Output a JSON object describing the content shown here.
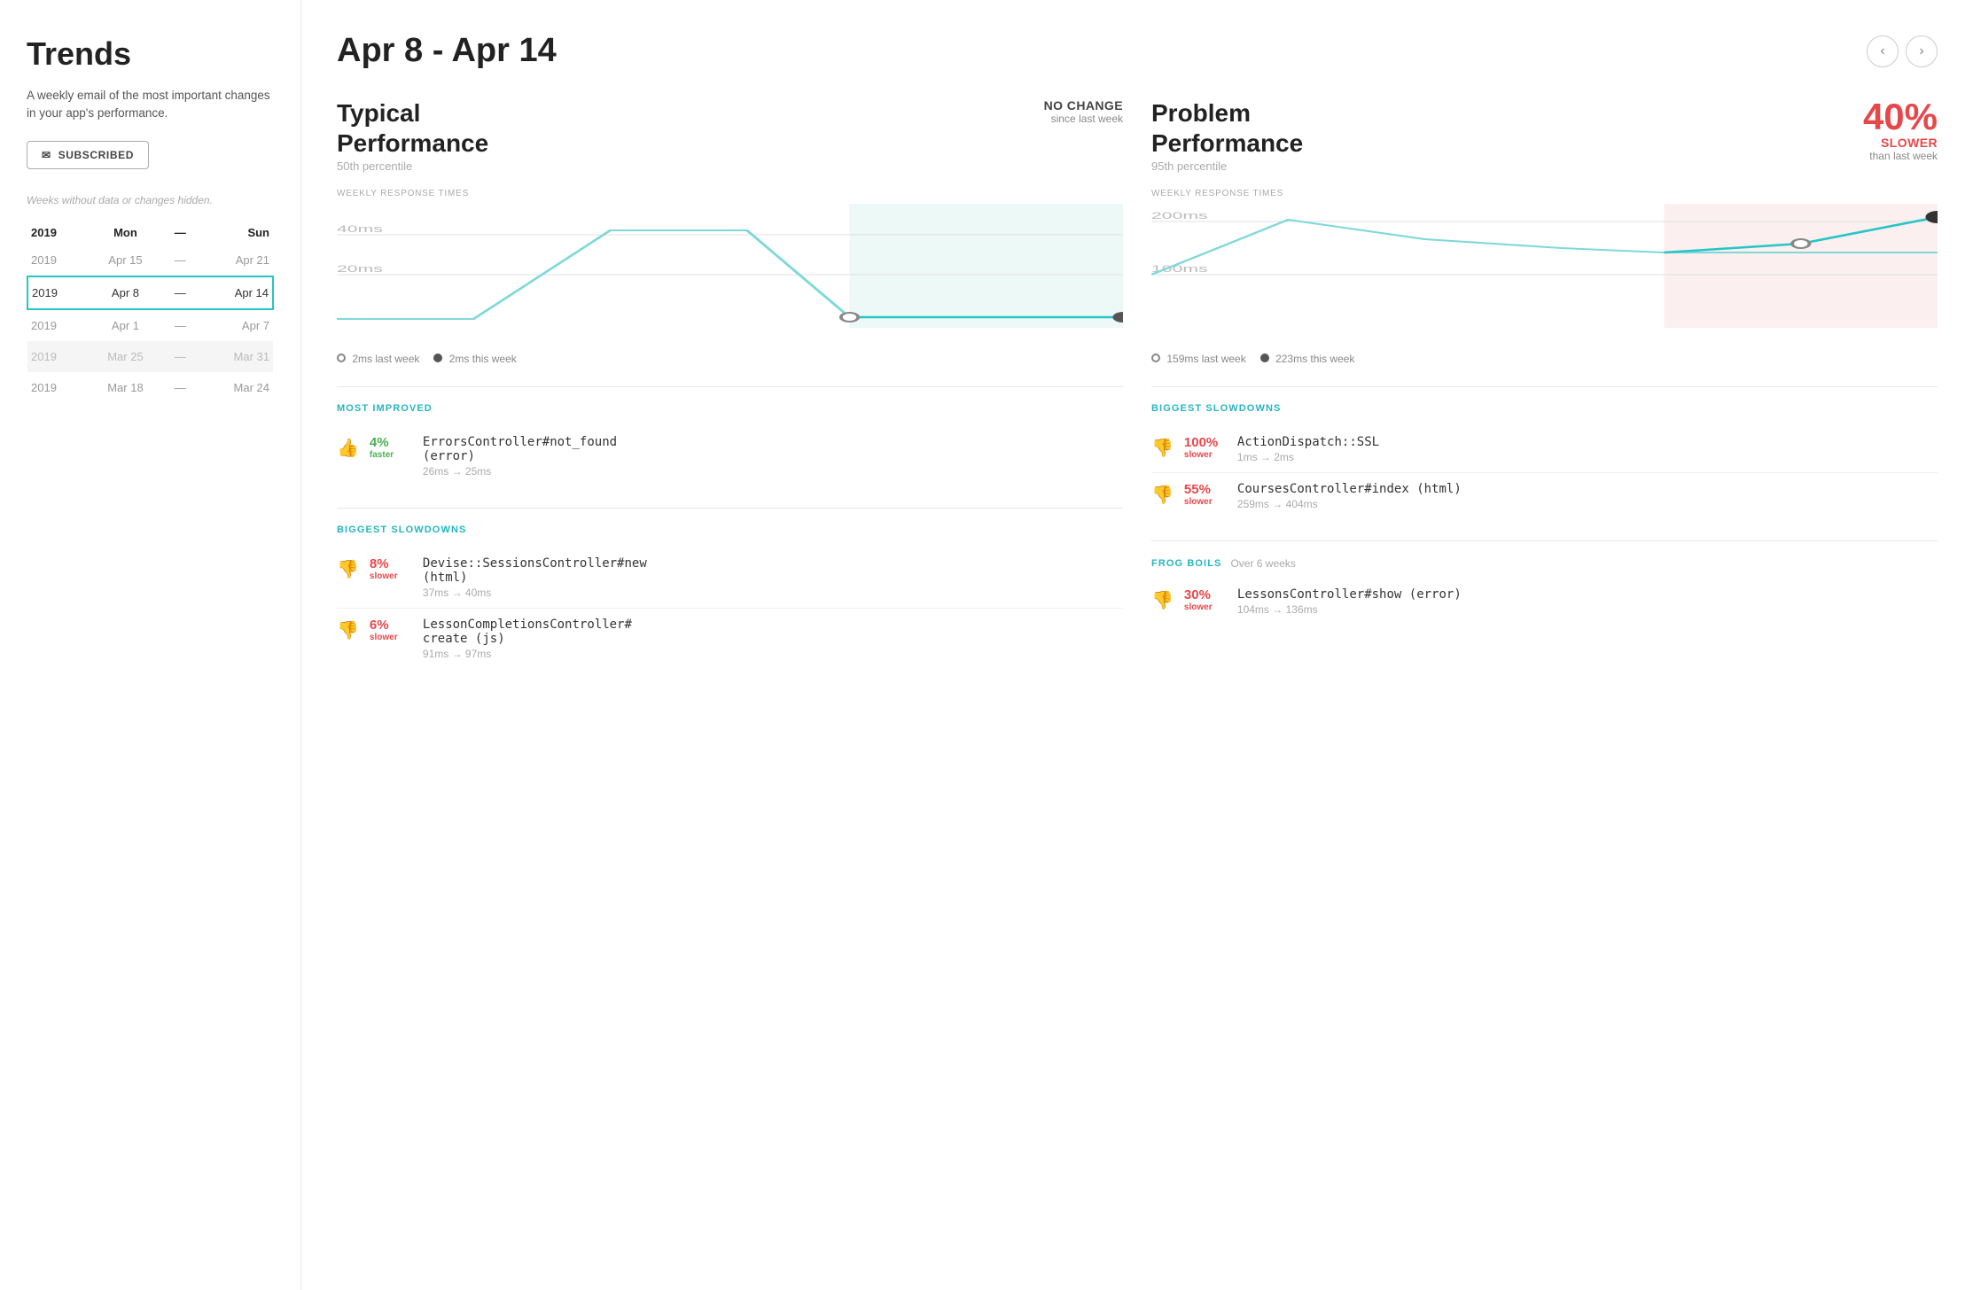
{
  "sidebar": {
    "title": "Trends",
    "description": "A weekly email of the most important changes in your app's performance.",
    "subscribe_button": "SUBSCRIBED",
    "weeks_hidden_note": "Weeks without data or changes hidden.",
    "table_headers": {
      "year": "2019",
      "mon": "Mon",
      "dash": "—",
      "sun": "Sun"
    },
    "weeks": [
      {
        "year": "2019",
        "mon": "Apr 15",
        "sun": "Apr 21",
        "state": "normal"
      },
      {
        "year": "2019",
        "mon": "Apr 8",
        "sun": "Apr 14",
        "state": "selected"
      },
      {
        "year": "2019",
        "mon": "Apr 1",
        "sun": "Apr 7",
        "state": "normal"
      },
      {
        "year": "2019",
        "mon": "Mar 25",
        "sun": "Mar 31",
        "state": "grayed"
      },
      {
        "year": "2019",
        "mon": "Mar 18",
        "sun": "Mar 24",
        "state": "normal"
      }
    ]
  },
  "main": {
    "date_range": "Apr 8 - Apr 14",
    "nav_prev": "‹",
    "nav_next": "›",
    "typical_performance": {
      "title": "Typical\nPerformance",
      "subtitle": "50th percentile",
      "change_label": "NO CHANGE",
      "change_sub": "since last week",
      "chart_label": "WEEKLY RESPONSE TIMES",
      "chart_y_labels": [
        "40ms",
        "20ms"
      ],
      "legend_last": "2ms last week",
      "legend_this": "2ms this week"
    },
    "problem_performance": {
      "title": "Problem\nPerformance",
      "subtitle": "95th percentile",
      "change_pct": "40%",
      "change_label": "SLOWER",
      "change_sub": "than last week",
      "chart_label": "WEEKLY RESPONSE TIMES",
      "chart_y_labels": [
        "200ms",
        "100ms"
      ],
      "legend_last": "159ms last week",
      "legend_this": "223ms this week"
    },
    "typical_most_improved": {
      "section_title": "MOST IMPROVED",
      "items": [
        {
          "icon": "👍",
          "pct": "4%",
          "pct_label": "faster",
          "pct_color": "green",
          "name": "ErrorsController#not_found\n(error)",
          "timing": "26ms → 25ms"
        }
      ]
    },
    "typical_biggest_slowdowns": {
      "section_title": "BIGGEST SLOWDOWNS",
      "items": [
        {
          "icon": "👎",
          "pct": "8%",
          "pct_label": "slower",
          "pct_color": "red",
          "name": "Devise::SessionsController#new\n(html)",
          "timing": "37ms → 40ms"
        },
        {
          "icon": "👎",
          "pct": "6%",
          "pct_label": "slower",
          "pct_color": "red",
          "name": "LessonCompletionsController#\ncreate (js)",
          "timing": "91ms → 97ms"
        }
      ]
    },
    "problem_biggest_slowdowns": {
      "section_title": "BIGGEST SLOWDOWNS",
      "items": [
        {
          "icon": "👎",
          "pct": "100%",
          "pct_label": "slower",
          "pct_color": "red",
          "name": "ActionDispatch::SSL",
          "timing": "1ms → 2ms"
        },
        {
          "icon": "👎",
          "pct": "55%",
          "pct_label": "slower",
          "pct_color": "red",
          "name": "CoursesController#index (html)",
          "timing": "259ms → 404ms"
        }
      ]
    },
    "problem_frog_boils": {
      "section_title": "FROG BOILS",
      "section_sub": "Over 6 weeks",
      "items": [
        {
          "icon": "👎",
          "pct": "30%",
          "pct_label": "slower",
          "pct_color": "red",
          "name": "LessonsController#show (error)",
          "timing": "104ms → 136ms"
        }
      ]
    }
  }
}
